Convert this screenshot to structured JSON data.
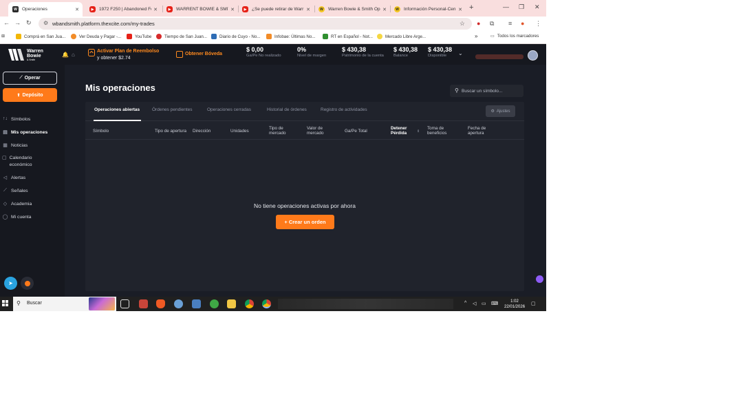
{
  "browser": {
    "tabs": [
      {
        "title": "Operaciones",
        "icon": "wb"
      },
      {
        "title": "1972 F250 | Abandoned Fo",
        "icon": "yt"
      },
      {
        "title": "WARRENT BOWIE & SMITH",
        "icon": "yt"
      },
      {
        "title": "¿Se puede retirar de Warr",
        "icon": "yt"
      },
      {
        "title": "Warren Bowie & Smith Op",
        "icon": "ww"
      },
      {
        "title": "Información Personal-Cen",
        "icon": "ww"
      }
    ],
    "new_tab": "+",
    "url": "wbandsmith.platform.thexcite.com/my-trades",
    "bookmarks": [
      {
        "label": "Comprá en San Jua...",
        "color": "#f2b705"
      },
      {
        "label": "Ver Deuda y Pagar -...",
        "color": "#f28c28"
      },
      {
        "label": "YouTube",
        "color": "#e62117"
      },
      {
        "label": "Tiempo de San Juan...",
        "color": "#d62b2b"
      },
      {
        "label": "Diario de Cuyo - No...",
        "color": "#2f6db5"
      },
      {
        "label": "Infobae: Últimas No...",
        "color": "#f28c28"
      },
      {
        "label": "RT en Español - Not...",
        "color": "#2f8f2f"
      },
      {
        "label": "Mercado Libre Arge...",
        "color": "#f5d742"
      }
    ],
    "all_bookmarks": "Todos los marcadores",
    "more_bookmarks": "»"
  },
  "app": {
    "logo_line1": "Warren",
    "logo_line2": "Bowie",
    "logo_line3": "& Smith",
    "promo_title": "Activar Plan de Reembolso",
    "promo_sub": "y obtener $2.74",
    "vault_label": "Obtener Bóveda",
    "stats": [
      {
        "value": "$ 0,00",
        "label": "Ga/Pe No realizado"
      },
      {
        "value": "0%",
        "label": "Nivel de margen"
      },
      {
        "value": "$ 430,38",
        "label": "Patrimonio de la cuenta"
      },
      {
        "value": "$ 430,38",
        "label": "Balance"
      },
      {
        "value": "$ 430,38",
        "label": "Disponible"
      }
    ]
  },
  "sidebar": {
    "operar": "Operar",
    "deposito": "Depósito",
    "items": [
      {
        "label": "Símbolos",
        "icon": "↑↓"
      },
      {
        "label": "Mis operaciones",
        "icon": "▤"
      },
      {
        "label": "Noticias",
        "icon": "▦"
      },
      {
        "label": "Calendario económico",
        "icon": "▢"
      },
      {
        "label": "Alertas",
        "icon": "◁"
      },
      {
        "label": "Señales",
        "icon": "⟋"
      },
      {
        "label": "Academia",
        "icon": "◇"
      },
      {
        "label": "Mi cuenta",
        "icon": "◯"
      }
    ]
  },
  "main": {
    "title": "Mis operaciones",
    "search_placeholder": "Buscar un símbolo...",
    "tabs": [
      "Operaciones abiertas",
      "Órdenes pendientes",
      "Operaciones cerradas",
      "Historial de órdenes",
      "Registro de actividades"
    ],
    "settings_label": "Ajustes",
    "columns": [
      "Símbolo",
      "Tipo de apertura",
      "Dirección",
      "Unidades",
      "Tipo de mercado",
      "Valor de mercado",
      "Ga/Pe Total",
      "Detener Pérdida",
      "Toma de beneficios",
      "Fecha de apertura"
    ],
    "empty_message": "No tiene operaciones activas por ahora",
    "create_button": "+ Crear un orden"
  },
  "taskbar": {
    "search": "Buscar",
    "time": "1:02",
    "date": "22/01/2026"
  }
}
